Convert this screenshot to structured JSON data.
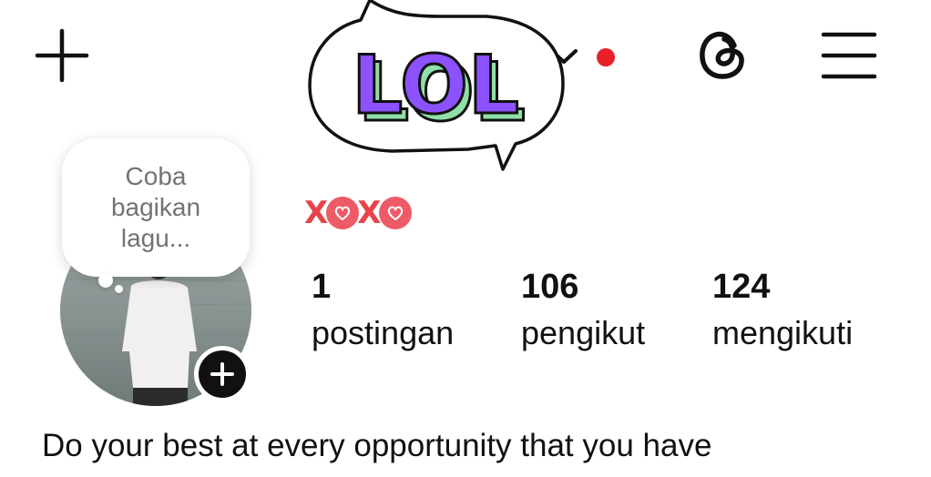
{
  "header": {
    "create_icon": "plus-icon",
    "account_switcher_icon": "chevron-down-icon",
    "notification_dot_color": "#e8202a",
    "threads_icon": "threads-icon",
    "menu_icon": "hamburger-menu-icon"
  },
  "sticker": {
    "text": "LOL",
    "fill_color": "#8c52ff",
    "shadow_color": "#8fe0a8"
  },
  "profile": {
    "display_name_sticker": "XOXO",
    "note": {
      "text": "Coba bagikan lagu..."
    },
    "avatar_icon": "profile-photo",
    "add_story_icon": "plus-icon"
  },
  "stats": [
    {
      "value": "1",
      "label": "postingan"
    },
    {
      "value": "106",
      "label": "pengikut"
    },
    {
      "value": "124",
      "label": "mengikuti"
    }
  ],
  "bio": "Do your best at every opportunity that you have"
}
